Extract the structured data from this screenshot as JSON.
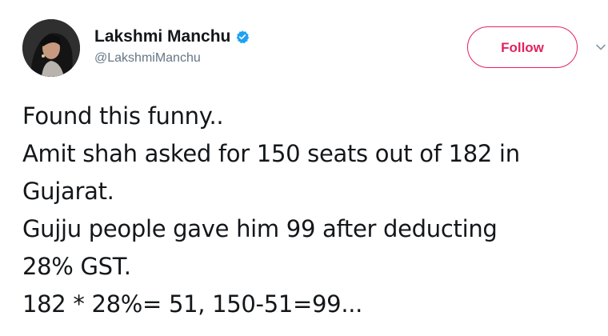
{
  "author": {
    "display_name": "Lakshmi Manchu",
    "handle": "@LakshmiManchu",
    "verified": true,
    "avatar_icon": "profile-photo"
  },
  "actions": {
    "follow_label": "Follow",
    "menu_icon": "chevron-down-icon"
  },
  "tweet": {
    "lines": [
      "Found this funny..",
      "Amit shah asked for 150 seats out of 182 in",
      "Gujarat.",
      "Gujju people gave him 99 after deducting",
      "28% GST.",
      "182 * 28%= 51, 150-51=99..."
    ]
  },
  "colors": {
    "follow_accent": "#e0245e",
    "verified_blue": "#1da1f2",
    "text_primary": "#14171a",
    "text_secondary": "#657786"
  }
}
